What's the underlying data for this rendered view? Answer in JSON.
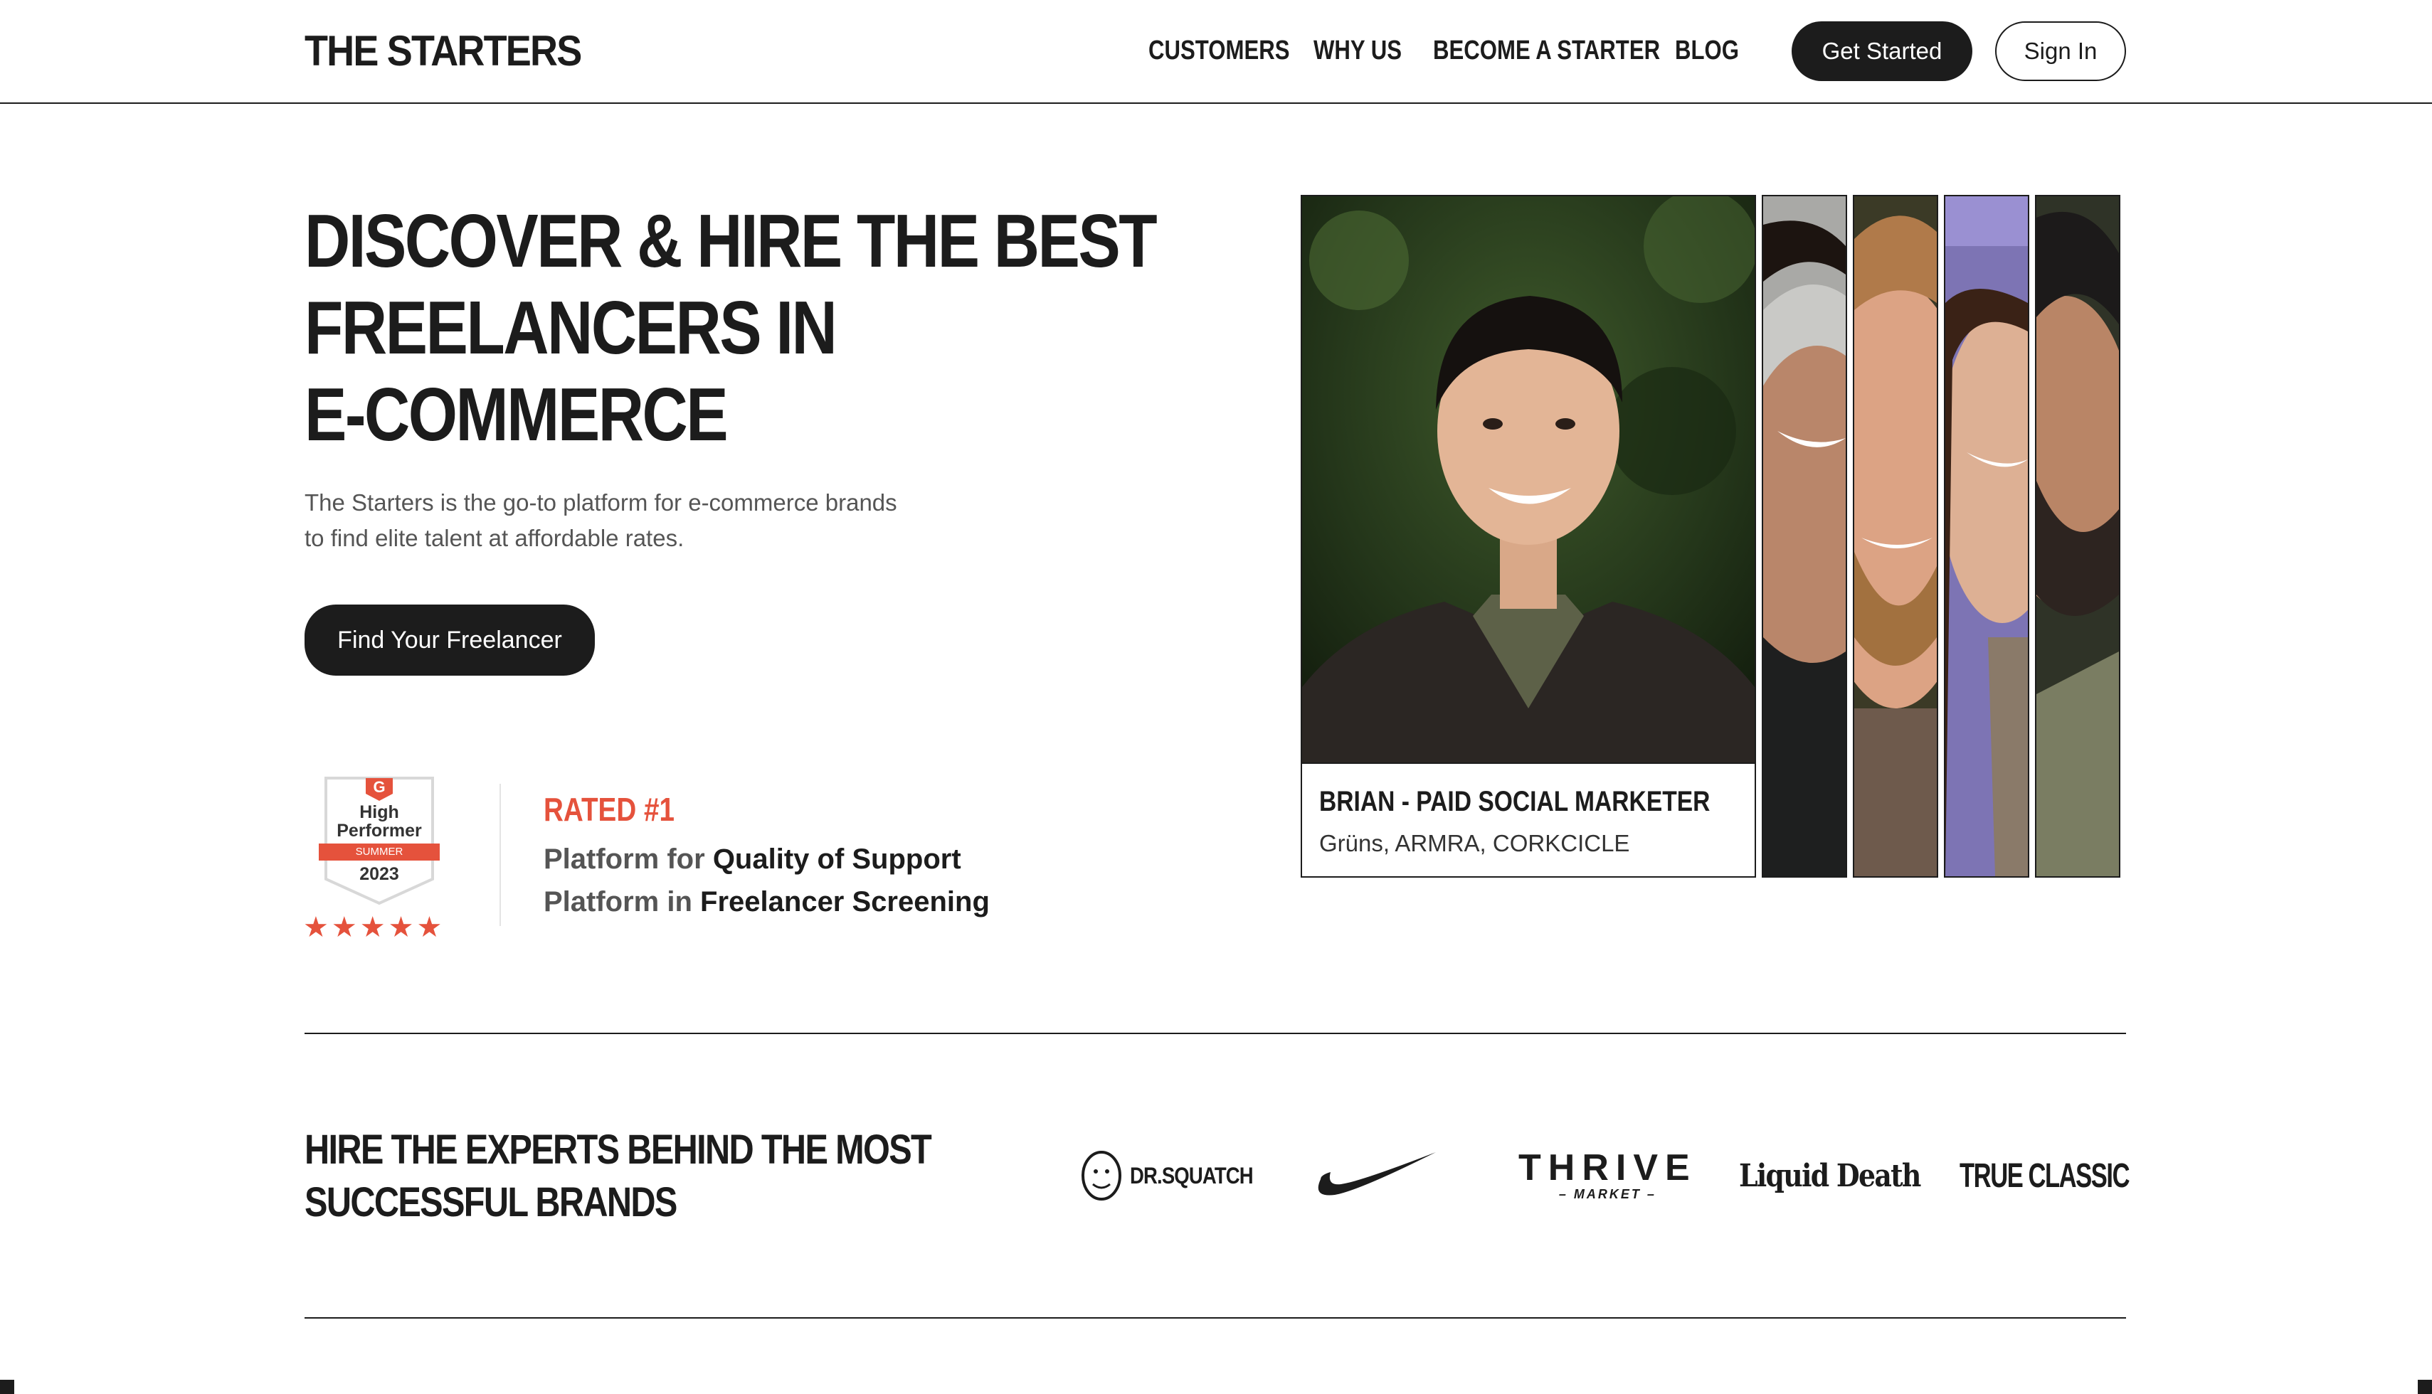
{
  "header": {
    "logo": "THE STARTERS",
    "nav": [
      "CUSTOMERS",
      "WHY US",
      "BECOME A STARTER",
      "BLOG"
    ],
    "get_started": "Get Started",
    "sign_in": "Sign In"
  },
  "hero": {
    "title_lines": [
      "DISCOVER & HIRE THE BEST",
      "FREELANCERS IN",
      "E-COMMERCE"
    ],
    "subtitle": "The Starters is the go-to platform for e-commerce brands to find elite talent at affordable rates.",
    "cta": "Find Your Freelancer"
  },
  "award": {
    "badge_g2": "G",
    "badge_line1": "High",
    "badge_line2": "Performer",
    "badge_season": "SUMMER",
    "badge_year": "2023",
    "stars": "★★★★★",
    "rated": "RATED #1",
    "lines": [
      {
        "prefix": "Platform for",
        "strong": "Quality of Support"
      },
      {
        "prefix": "Platform in",
        "strong": "Freelancer Screening"
      }
    ]
  },
  "featured": {
    "name_role": "BRIAN - PAID SOCIAL MARKETER",
    "brands": "Grüns, ARMRA, CORKCICLE"
  },
  "brands_section": {
    "title_lines": [
      "HIRE THE EXPERTS BEHIND THE MOST",
      "SUCCESSFUL BRANDS"
    ],
    "logos": {
      "drsquatch": "DR.SQUATCH",
      "nike": "nike-swoosh-icon",
      "thrive": "THRIVE",
      "thrive_sub": "– MARKET –",
      "liquid_death": "Liquid Death",
      "true_classic": "TRUE CLASSIC"
    }
  },
  "colors": {
    "ink": "#1c1c1c",
    "accent": "#e5523c",
    "muted": "#555555"
  }
}
